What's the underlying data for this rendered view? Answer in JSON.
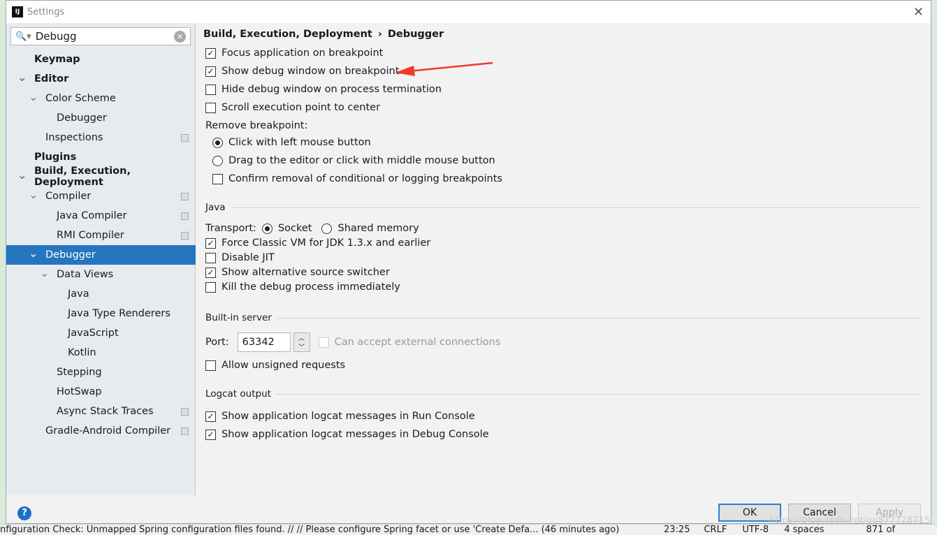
{
  "window": {
    "title": "Settings",
    "logo": "IJ"
  },
  "search": {
    "value": "Debugg"
  },
  "tree": [
    {
      "label": "Keymap",
      "level": 0,
      "bold": true
    },
    {
      "label": "Editor",
      "level": 0,
      "bold": true,
      "expanded": true
    },
    {
      "label": "Color Scheme",
      "level": 1,
      "expanded": true
    },
    {
      "label": "Debugger",
      "level": 2
    },
    {
      "label": "Inspections",
      "level": 1,
      "copy": true
    },
    {
      "label": "Plugins",
      "level": 0,
      "bold": true
    },
    {
      "label": "Build, Execution, Deployment",
      "level": 0,
      "bold": true,
      "expanded": true
    },
    {
      "label": "Compiler",
      "level": 1,
      "expanded": true,
      "copy": true
    },
    {
      "label": "Java Compiler",
      "level": 2,
      "copy": true
    },
    {
      "label": "RMI Compiler",
      "level": 2,
      "copy": true
    },
    {
      "label": "Debugger",
      "level": 1,
      "expanded": true,
      "selected": true
    },
    {
      "label": "Data Views",
      "level": 2,
      "expanded": true
    },
    {
      "label": "Java",
      "level": 3
    },
    {
      "label": "Java Type Renderers",
      "level": 3
    },
    {
      "label": "JavaScript",
      "level": 3
    },
    {
      "label": "Kotlin",
      "level": 3
    },
    {
      "label": "Stepping",
      "level": 2
    },
    {
      "label": "HotSwap",
      "level": 2
    },
    {
      "label": "Async Stack Traces",
      "level": 2,
      "copy": true
    },
    {
      "label": "Gradle-Android Compiler",
      "level": 1,
      "copy": true
    }
  ],
  "breadcrumb": {
    "parent": "Build, Execution, Deployment",
    "sep": "›",
    "current": "Debugger"
  },
  "general": [
    {
      "label": "Focus application on breakpoint",
      "checked": true
    },
    {
      "label": "Show debug window on breakpoint",
      "checked": true
    },
    {
      "label": "Hide debug window on process termination",
      "checked": false
    },
    {
      "label": "Scroll execution point to center",
      "checked": false
    }
  ],
  "remove_breakpoint": {
    "label": "Remove breakpoint:",
    "options": [
      {
        "label": "Click with left mouse button",
        "selected": true
      },
      {
        "label": "Drag to the editor or click with middle mouse button",
        "selected": false
      }
    ],
    "confirm": {
      "label": "Confirm removal of conditional or logging breakpoints",
      "checked": false
    }
  },
  "java": {
    "title": "Java",
    "transport_label": "Transport:",
    "transport": [
      {
        "label": "Socket",
        "selected": true
      },
      {
        "label": "Shared memory",
        "selected": false
      }
    ],
    "options": [
      {
        "label": "Force Classic VM for JDK 1.3.x and earlier",
        "checked": true
      },
      {
        "label": "Disable JIT",
        "checked": false
      },
      {
        "label": "Show alternative source switcher",
        "checked": true
      },
      {
        "label": "Kill the debug process immediately",
        "checked": false
      }
    ]
  },
  "server": {
    "title": "Built-in server",
    "port_label": "Port:",
    "port": "63342",
    "external": {
      "label": "Can accept external connections",
      "checked": false,
      "disabled": true
    },
    "unsigned": {
      "label": "Allow unsigned requests",
      "checked": false
    }
  },
  "logcat": {
    "title": "Logcat output",
    "options": [
      {
        "label": "Show application logcat messages in Run Console",
        "checked": true
      },
      {
        "label": "Show application logcat messages in Debug Console",
        "checked": true
      }
    ]
  },
  "buttons": {
    "ok": "OK",
    "cancel": "Cancel",
    "apply": "Apply",
    "help": "?"
  },
  "statusbar": {
    "message": "nfiguration Check: Unmapped Spring configuration files found. // // Please configure Spring facet or use 'Create Defa... (46 minutes ago)",
    "position": "23:25",
    "line_sep": "CRLF",
    "encoding": "UTF-8",
    "indent": "4 spaces",
    "lines": "871 of"
  },
  "watermark": "https://blog.csdn.net/qq877728715",
  "colors": {
    "selection": "#2675bf",
    "annotation_arrow": "#f03a2a"
  }
}
